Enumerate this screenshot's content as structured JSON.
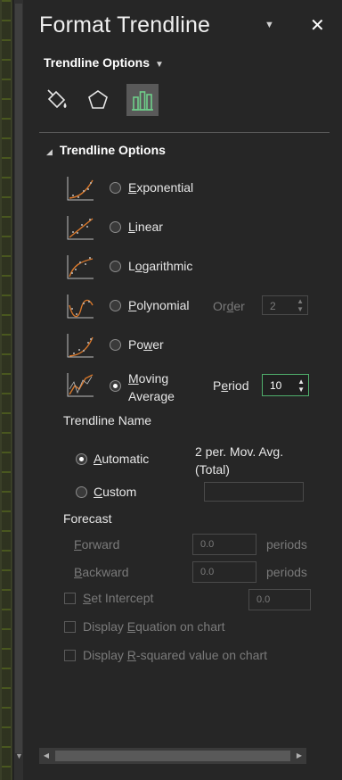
{
  "pane": {
    "title": "Format Trendline",
    "menu_glyph": "▼",
    "close_glyph": "✕",
    "options_dropdown": "Trendline Options",
    "tabs": [
      {
        "name": "fill-line",
        "icon": "paint-bucket-icon",
        "active": false
      },
      {
        "name": "effects",
        "icon": "pentagon-icon",
        "active": false
      },
      {
        "name": "trendline-options",
        "icon": "bar-chart-icon",
        "active": true
      }
    ],
    "section_title": "Trendline Options"
  },
  "types": [
    {
      "label_pre": "",
      "label_u": "E",
      "label_post": "xponential",
      "selected": false
    },
    {
      "label_pre": "",
      "label_u": "L",
      "label_post": "inear",
      "selected": false
    },
    {
      "label_pre": "L",
      "label_u": "o",
      "label_post": "garithmic",
      "selected": false
    },
    {
      "label_pre": "",
      "label_u": "P",
      "label_post": "olynomial",
      "selected": false
    },
    {
      "label_pre": "Po",
      "label_u": "w",
      "label_post": "er",
      "selected": false
    },
    {
      "label_pre": "",
      "label_u": "M",
      "label_post": "oving",
      "label_line2": "Average",
      "selected": true
    }
  ],
  "order": {
    "label_pre": "Or",
    "label_u": "d",
    "label_post": "er",
    "value": "2"
  },
  "period": {
    "label_pre": "P",
    "label_u": "e",
    "label_post": "riod",
    "value": "10"
  },
  "trendline_name": {
    "heading": "Trendline Name",
    "automatic": {
      "label_u": "A",
      "label_post": "utomatic",
      "value_line1": "2 per. Mov. Avg.",
      "value_line2": "(Total)",
      "selected": true
    },
    "custom": {
      "label_u": "C",
      "label_post": "ustom",
      "value": "",
      "selected": false
    }
  },
  "forecast": {
    "heading": "Forecast",
    "forward": {
      "label_u": "F",
      "label_post": "orward",
      "value": "0.0",
      "unit": "periods"
    },
    "backward": {
      "label_u": "B",
      "label_post": "ackward",
      "value": "0.0",
      "unit": "periods"
    }
  },
  "checks": {
    "set_intercept": {
      "label_u": "S",
      "label_post": "et Intercept",
      "value": "0.0"
    },
    "display_equation": {
      "label_pre": "Display ",
      "label_u": "E",
      "label_post": "quation on chart"
    },
    "display_rsquared": {
      "label_pre": "Display ",
      "label_u": "R",
      "label_post": "-squared value on chart"
    }
  },
  "colors": {
    "accent_green": "#4fae6b",
    "trend_orange": "#d9782b",
    "panel_bg": "#262626"
  }
}
